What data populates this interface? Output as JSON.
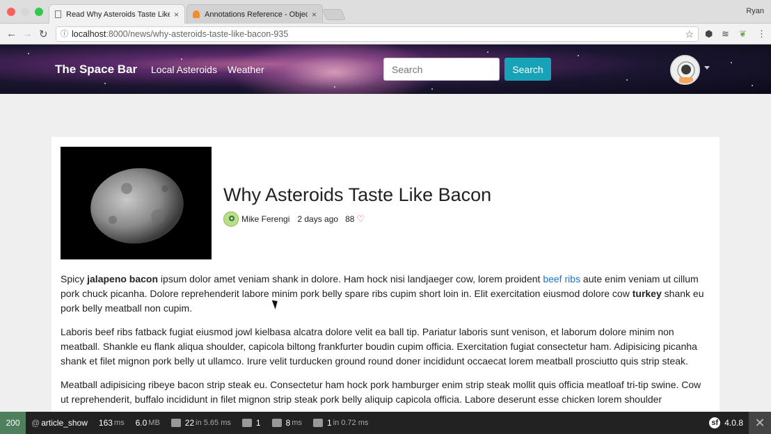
{
  "browser": {
    "tabs": [
      {
        "label": "Read Why Asteroids Taste Like",
        "close": "×"
      },
      {
        "label": "Annotations Reference - Objec",
        "close": "×"
      }
    ],
    "user": "Ryan",
    "url_host": "localhost",
    "url_path": ":8000/news/why-asteroids-taste-like-bacon-935"
  },
  "navbar": {
    "brand": "The Space Bar",
    "links": [
      "Local Asteroids",
      "Weather"
    ],
    "search_placeholder": "Search",
    "search_button": "Search"
  },
  "article": {
    "title": "Why Asteroids Taste Like Bacon",
    "author": "Mike Ferengi",
    "published": "2 days ago",
    "likes": "88",
    "p1_a": "Spicy ",
    "p1_b": "jalapeno bacon",
    "p1_c": " ipsum dolor amet veniam shank in dolore. Ham hock nisi landjaeger cow, lorem proident ",
    "p1_link": "beef ribs",
    "p1_d": " aute enim veniam ut cillum pork chuck picanha. Dolore reprehenderit labore minim pork belly spare ribs cupim short loin in. Elit exercitation eiusmod dolore cow ",
    "p1_e": "turkey",
    "p1_f": " shank eu pork belly meatball non cupim.",
    "p2": "Laboris beef ribs fatback fugiat eiusmod jowl kielbasa alcatra dolore velit ea ball tip. Pariatur laboris sunt venison, et laborum dolore minim non meatball. Shankle eu flank aliqua shoulder, capicola biltong frankfurter boudin cupim officia. Exercitation fugiat consectetur ham. Adipisicing picanha shank et filet mignon pork belly ut ullamco. Irure velit turducken ground round doner incididunt occaecat lorem meatball prosciutto quis strip steak.",
    "p3": "Meatball adipisicing ribeye bacon strip steak eu. Consectetur ham hock pork hamburger enim strip steak mollit quis officia meatloaf tri-tip swine. Cow ut reprehenderit, buffalo incididunt in filet mignon strip steak pork belly aliquip capicola officia. Labore deserunt esse chicken lorem shoulder"
  },
  "toolbar": {
    "status": "200",
    "route": "article_show",
    "time": "163",
    "time_unit": "ms",
    "memory": "6.0",
    "memory_unit": "MB",
    "queries": "22",
    "queries_unit": "in 5.65 ms",
    "logs": "1",
    "twig": "8",
    "twig_unit": "ms",
    "cache": "1",
    "cache_unit": "in 0.72 ms",
    "version": "4.0.8",
    "close": "✕"
  },
  "colors": {
    "search_button": "#17a2b8",
    "status_ok": "#4f805d",
    "link": "#1a73c6"
  }
}
